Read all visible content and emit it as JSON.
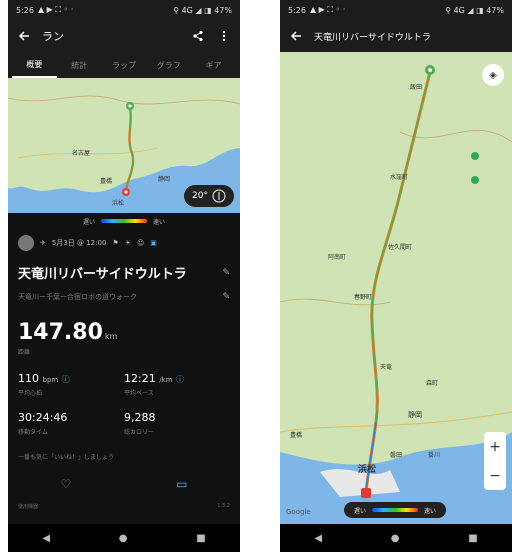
{
  "left": {
    "status": {
      "time": "5:26",
      "icons_left": "▲ ▶ ⛶ ◦ ·",
      "icons_right": "⚲ 4G ◢ ◨ 47%"
    },
    "topbar": {
      "title": "ラン"
    },
    "tabs": [
      "概要",
      "統計",
      "ラップ",
      "グラフ",
      "ギア"
    ],
    "map": {
      "temp_badge": "20°",
      "legend_slow": "遅い",
      "legend_fast": "速い",
      "cities": [
        "名古屋",
        "豊橋",
        "浜松",
        "静岡"
      ]
    },
    "meta": {
      "date": "5月3日 @ 12:00",
      "items": [
        "⚑",
        "☀",
        "☺"
      ]
    },
    "activity": {
      "title": "天竜川リバーサイドウルトラ",
      "description": "天竜川ー千葉ー合宿ロボの道ウォーク"
    },
    "distance": {
      "value": "147.80",
      "unit": "km",
      "label": "距離"
    },
    "stats": [
      {
        "value": "110",
        "unit": "bpm",
        "label": "平均心拍"
      },
      {
        "value": "12:21",
        "unit": "/km",
        "label": "平均ペース"
      },
      {
        "value": "30:24:46",
        "unit": "",
        "label": "移動タイム"
      },
      {
        "value": "9,288",
        "unit": "",
        "label": "総カロリー"
      }
    ],
    "more_text": "一番も気に「いいね！」しましょう",
    "bottom": {
      "left": "使用機器",
      "right": "1.3.2"
    }
  },
  "right": {
    "status": {
      "time": "5:26",
      "icons_left": "▲ ▶ ⛶ ◦ ·",
      "icons_right": "⚲ 4G ◢ ◨ 47%"
    },
    "topbar": {
      "title": "天竜川リバーサイドウルトラ"
    },
    "map": {
      "places": [
        "浜松",
        "静岡",
        "豊橋",
        "飯田",
        "天竜",
        "掛川",
        "磐田",
        "森町",
        "春野町",
        "佐久間町",
        "水窪町",
        "阿南町"
      ],
      "legend_slow": "遅い",
      "legend_fast": "速い",
      "google": "Google",
      "zoom_in": "+",
      "zoom_out": "−"
    }
  },
  "colors": {
    "route_green": "#4caf50",
    "route_blue": "#1e88e5",
    "map_land": "#cfe3b5",
    "sea": "#7fb6e8"
  }
}
